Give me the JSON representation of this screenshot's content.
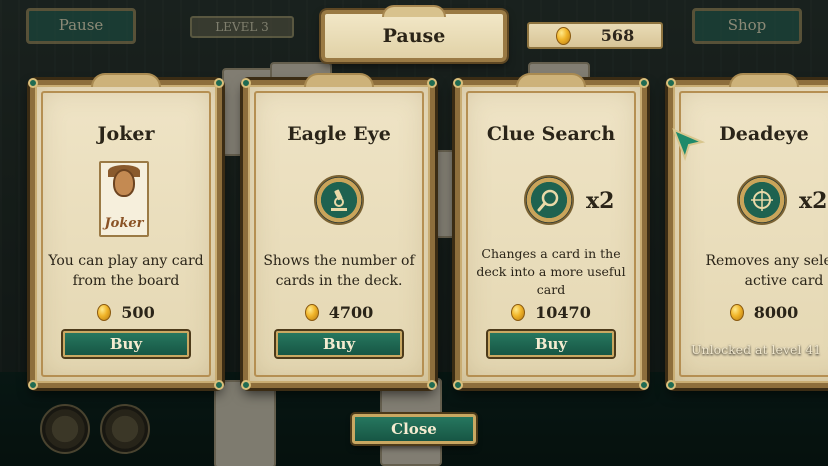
{
  "top_bar": {
    "pause_label": "Pause",
    "level_label": "LEVEL 3",
    "shop_label": "Shop",
    "title": "Pause",
    "coins": "568"
  },
  "cards": [
    {
      "title": "Joker",
      "art_label": "Joker",
      "icon": "joker-card-icon",
      "description": "You can play any card from the board",
      "price": "500",
      "action": "Buy"
    },
    {
      "title": "Eagle Eye",
      "icon": "microscope-icon",
      "description": "Shows the number of cards in the deck.",
      "price": "4700",
      "action": "Buy"
    },
    {
      "title": "Clue Search",
      "icon": "magnifier-icon",
      "multiplier": "x2",
      "description": "Changes a card in the deck into a more useful card",
      "price": "10470",
      "action": "Buy"
    },
    {
      "title": "Deadeye",
      "icon": "crosshair-icon",
      "multiplier": "x2",
      "description": "Removes any selected active card",
      "price": "8000",
      "locked_text": "Unlocked at level 41"
    }
  ],
  "close_label": "Close",
  "colors": {
    "accent_green": "#1c5a48",
    "parchment": "#ece1c2",
    "gold_frame": "#8d6e3c"
  }
}
